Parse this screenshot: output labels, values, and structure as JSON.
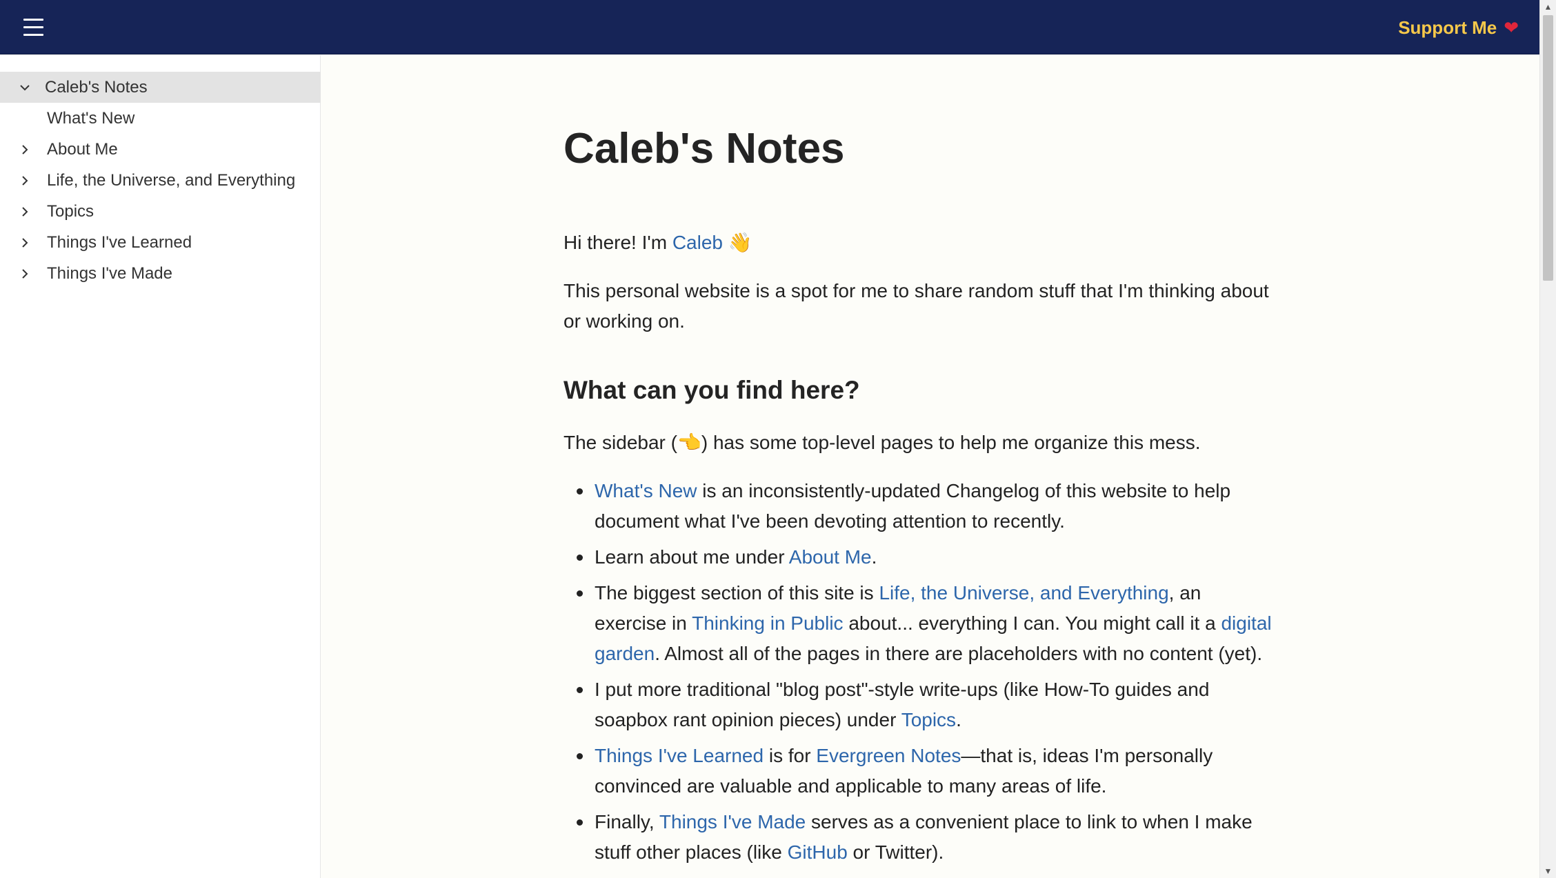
{
  "topbar": {
    "support_label": "Support Me",
    "support_icon": "heart-icon"
  },
  "sidebar": {
    "items": [
      {
        "label": "Caleb's Notes",
        "icon": "chevron-down-icon",
        "active": true
      },
      {
        "label": "What's New",
        "icon": ""
      },
      {
        "label": "About Me",
        "icon": "chevron-right-icon"
      },
      {
        "label": "Life, the Universe, and Everything",
        "icon": "chevron-right-icon"
      },
      {
        "label": "Topics",
        "icon": "chevron-right-icon"
      },
      {
        "label": "Things I've Learned",
        "icon": "chevron-right-icon"
      },
      {
        "label": "Things I've Made",
        "icon": "chevron-right-icon"
      }
    ]
  },
  "page": {
    "title": "Caleb's Notes",
    "greeting_prefix": "Hi there! I'm ",
    "greeting_link": "Caleb",
    "greeting_emoji": "👋",
    "intro": "This personal website is a spot for me to share random stuff that I'm thinking about or working on.",
    "section_heading": "What can you find here?",
    "sidebar_note_prefix": "The sidebar (",
    "sidebar_note_emoji": "👈",
    "sidebar_note_suffix": ") has some top-level pages to help me organize this mess.",
    "bullets": {
      "b1": {
        "link1": "What's New",
        "text1": " is an inconsistently-updated Changelog of this website to help document what I've been devoting attention to recently."
      },
      "b2": {
        "text1": "Learn about me under ",
        "link1": "About Me",
        "text2": "."
      },
      "b3": {
        "text1": "The biggest section of this site is ",
        "link1": "Life, the Universe, and Everything",
        "text2": ", an exercise in ",
        "link2": "Thinking in Public",
        "text3": " about... everything I can. You might call it a ",
        "link3": "digital garden",
        "text4": ". Almost all of the pages in there are placeholders with no content (yet)."
      },
      "b4": {
        "text1": "I put more traditional \"blog post\"-style write-ups (like How-To guides and soapbox rant opinion pieces) under ",
        "link1": "Topics",
        "text2": "."
      },
      "b5": {
        "link1": "Things I've Learned",
        "text1": " is for ",
        "link2": "Evergreen Notes",
        "text2": "—that is, ideas I'm personally convinced are valuable and applicable to many areas of life."
      },
      "b6": {
        "text1": "Finally, ",
        "link1": "Things I've Made",
        "text2": " serves as a convenient place to link to when I make stuff other places (like ",
        "link2": "GitHub",
        "text3": " or Twitter)."
      }
    }
  },
  "colors": {
    "topbar_bg": "#162457",
    "support_text": "#f6c84a",
    "link": "#2d66ab",
    "active_nav_bg": "#e3e3e3"
  }
}
